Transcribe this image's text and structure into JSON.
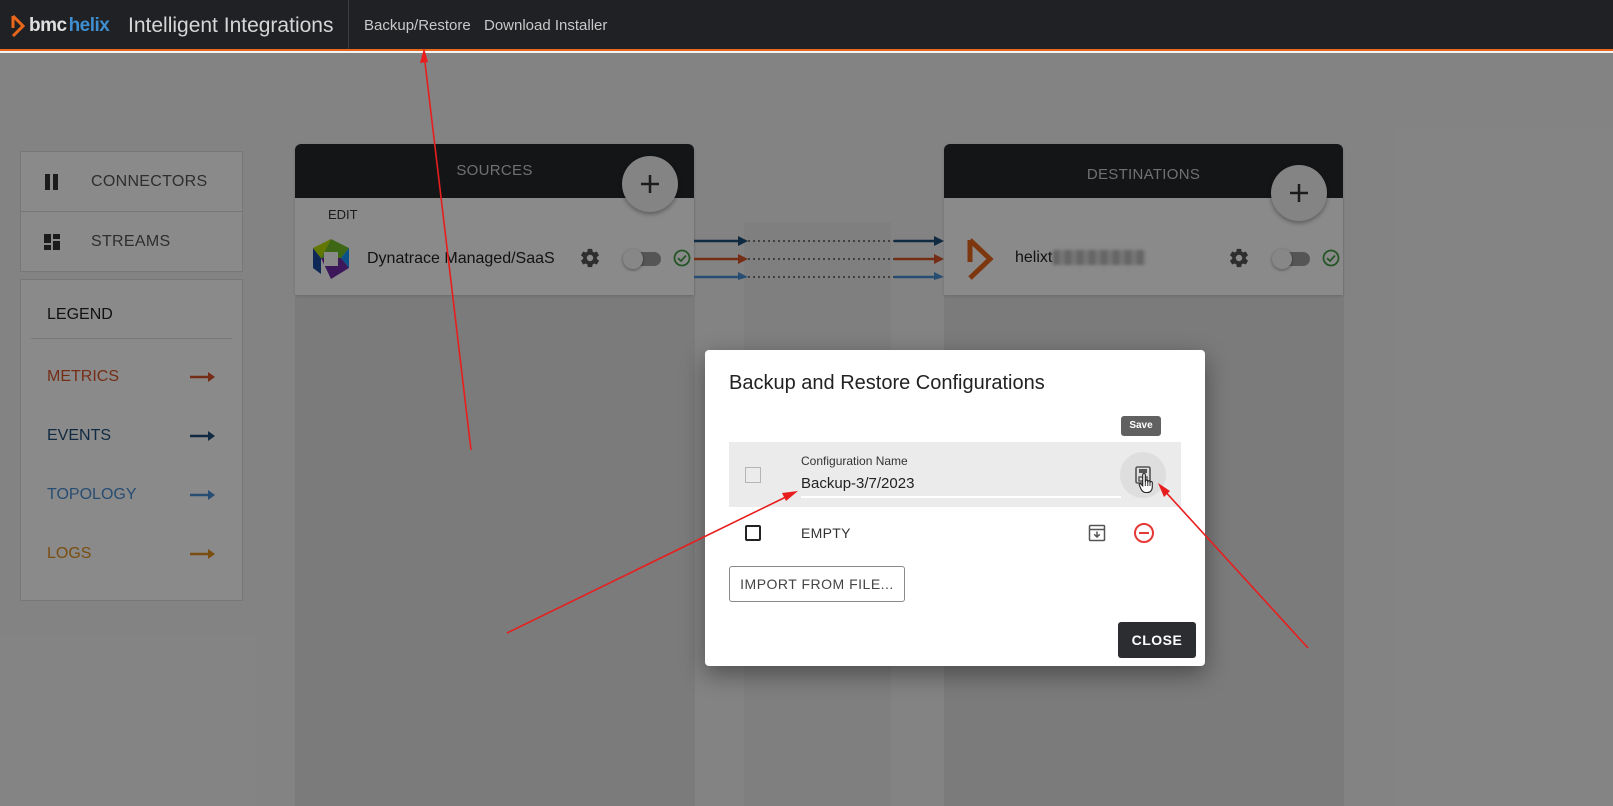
{
  "header": {
    "brand_bmc": "bmc",
    "brand_helix": "helix",
    "app_title": "Intelligent Integrations",
    "nav": [
      {
        "label": "Backup/Restore"
      },
      {
        "label": "Download Installer"
      }
    ]
  },
  "sidebar": {
    "items": [
      {
        "label": "CONNECTORS",
        "icon": "connectors-icon"
      },
      {
        "label": "STREAMS",
        "icon": "streams-icon"
      }
    ]
  },
  "legend": {
    "title": "LEGEND",
    "items": [
      {
        "label": "METRICS",
        "color": "#d9542a"
      },
      {
        "label": "EVENTS",
        "color": "#1f4e79"
      },
      {
        "label": "TOPOLOGY",
        "color": "#4a8fd2"
      },
      {
        "label": "LOGS",
        "color": "#e0901e"
      }
    ]
  },
  "sources": {
    "title": "SOURCES",
    "edit_label": "EDIT",
    "connector_name": "Dynatrace Managed/SaaS"
  },
  "destinations": {
    "title": "DESTINATIONS",
    "connector_name": "helixt"
  },
  "modal": {
    "title": "Backup and Restore Configurations",
    "tooltip": "Save",
    "field_label": "Configuration Name",
    "field_value": "Backup-3/7/2023",
    "row_name": "EMPTY",
    "import_label": "IMPORT FROM FILE...",
    "close_label": "CLOSE"
  },
  "colors": {
    "accent": "#e8671b",
    "topbar": "#1f2124",
    "danger": "#e53935",
    "success": "#43a047",
    "annotation_arrow": "#e81e1e"
  }
}
